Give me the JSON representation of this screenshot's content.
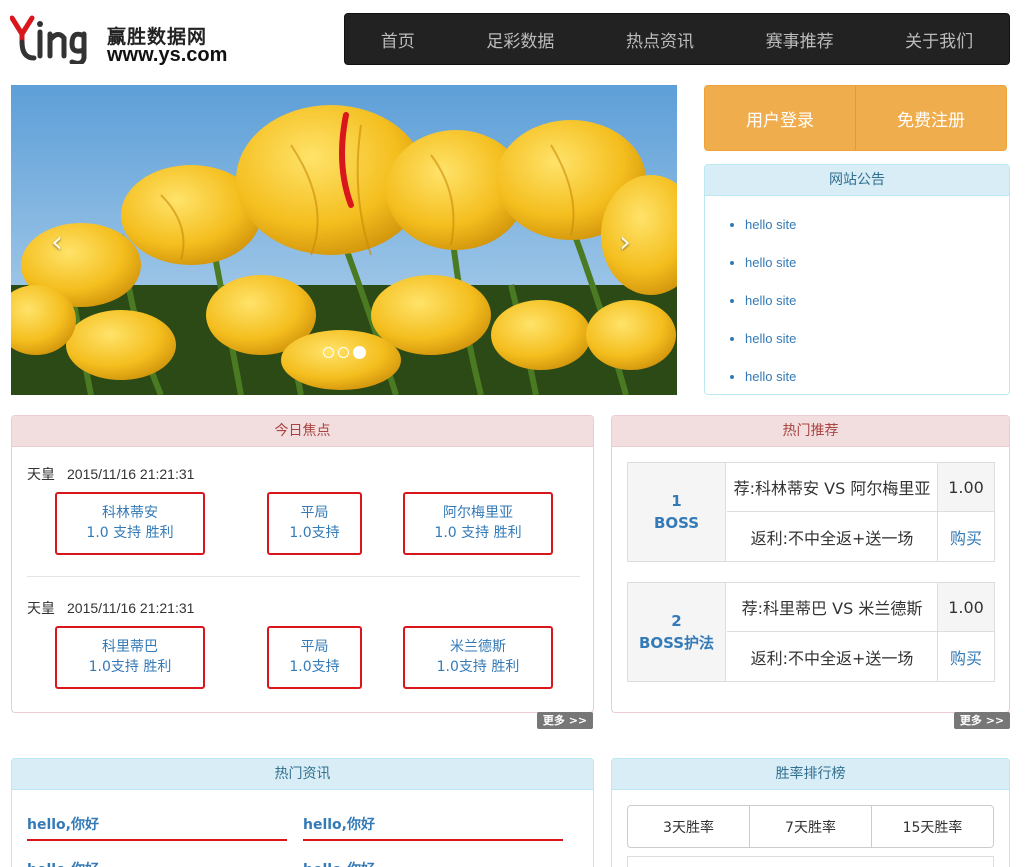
{
  "logo": {
    "name": "赢胜数据网",
    "url": "www.ys.com"
  },
  "nav": [
    "首页",
    "足彩数据",
    "热点资讯",
    "赛事推荐",
    "关于我们"
  ],
  "carousel": {
    "prev": "‹",
    "next": "›",
    "slides": 3,
    "active_index": 2
  },
  "login": {
    "login_label": "用户登录",
    "register_label": "免费注册"
  },
  "notice": {
    "title": "网站公告",
    "items": [
      "hello site",
      "hello site",
      "hello site",
      "hello site",
      "hello site"
    ]
  },
  "focus": {
    "title": "今日焦点",
    "matches": [
      {
        "league": "天皇",
        "time": "2015/11/16 21:21:31",
        "home": {
          "line1": "科林蒂安",
          "line2": "1.0 支持 胜利"
        },
        "draw": {
          "line1": "平局",
          "line2": "1.0支持"
        },
        "away": {
          "line1": "阿尔梅里亚",
          "line2": "1.0 支持 胜利"
        }
      },
      {
        "league": "天皇",
        "time": "2015/11/16 21:21:31",
        "home": {
          "line1": "科里蒂巴",
          "line2": "1.0支持 胜利"
        },
        "draw": {
          "line1": "平局",
          "line2": "1.0支持"
        },
        "away": {
          "line1": "米兰德斯",
          "line2": "1.0支持 胜利"
        }
      }
    ],
    "more": "更多 >>"
  },
  "hot": {
    "title": "热门推荐",
    "items": [
      {
        "num": "1",
        "label": "BOSS",
        "match": "荐:科林蒂安 VS 阿尔梅里亚",
        "odds": "1.00",
        "offer": "返利:不中全返+送一场",
        "buy": "购买"
      },
      {
        "num": "2",
        "label": "BOSS护法",
        "match": "荐:科里蒂巴 VS 米兰德斯",
        "odds": "1.00",
        "offer": "返利:不中全返+送一场",
        "buy": "购买"
      }
    ],
    "more": "更多 >>"
  },
  "news": {
    "title": "热门资讯",
    "items": [
      "hello,你好",
      "hello,你好",
      "hello,你好",
      "hello,你好"
    ]
  },
  "rank": {
    "title": "胜率排行榜",
    "tabs": [
      "3天胜率",
      "7天胜率",
      "15天胜率"
    ]
  }
}
